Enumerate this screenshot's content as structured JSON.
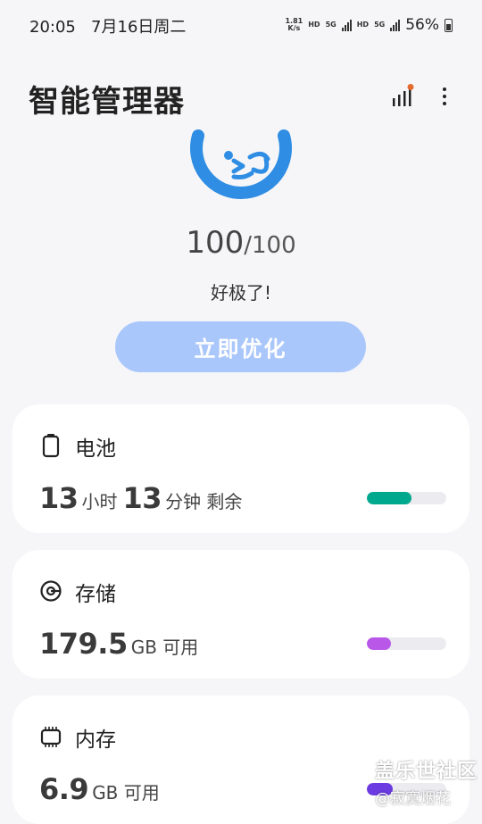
{
  "status_bar": {
    "time": "20:05",
    "date": "7月16日周二",
    "net_speed_value": "1.81",
    "net_speed_unit": "K/s",
    "hd1": "HD",
    "net1": "5G",
    "hd2": "HD",
    "net2": "5G",
    "battery": "56%"
  },
  "header": {
    "title": "智能管理器",
    "stats_icon": "signal-bars-icon",
    "more_icon": "more-vertical-icon"
  },
  "score": {
    "value": "100",
    "max": "/100",
    "status": "好极了!",
    "button_label": "立即优化"
  },
  "battery": {
    "title": "电池",
    "icon": "battery-icon",
    "hours": "13",
    "hours_unit": "小时",
    "minutes": "13",
    "minutes_unit": "分钟 剩余",
    "level": 0.56,
    "color": "#00a88e"
  },
  "storage": {
    "title": "存储",
    "icon": "storage-disc-icon",
    "value": "179.5",
    "unit": "GB 可用",
    "level": 0.3,
    "color": "#b857e8"
  },
  "memory": {
    "title": "内存",
    "icon": "memory-chip-icon",
    "value": "6.9",
    "unit": "GB 可用",
    "level": 0.33,
    "color": "#6b3ae0"
  },
  "watermark": {
    "line1": "盖乐世社区",
    "line2": "@寂寞烟花"
  },
  "colors": {
    "accent_blue": "#2f8de4",
    "button_bg": "#a9c7fb",
    "notification_dot": "#e46a2e"
  }
}
